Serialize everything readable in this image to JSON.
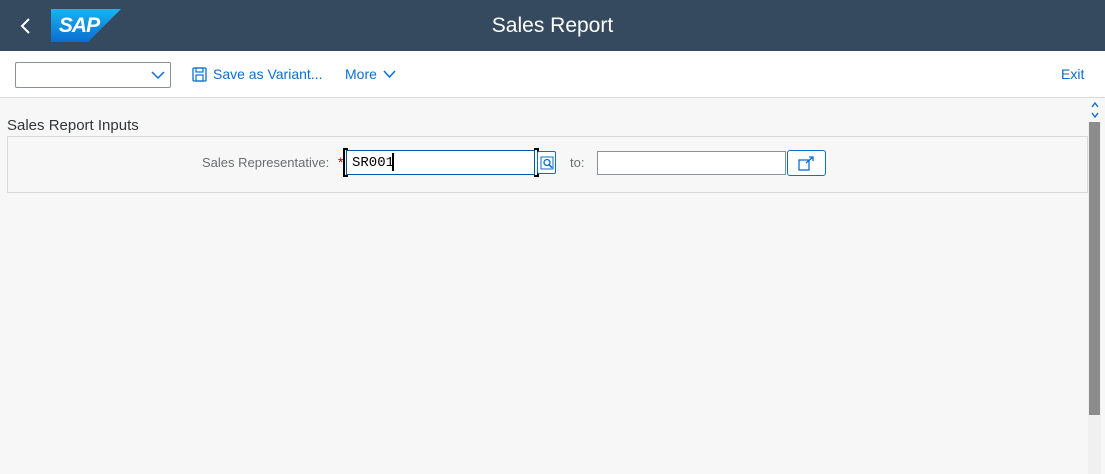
{
  "shell": {
    "logo_text": "SAP",
    "title": "Sales Report",
    "back_icon": "chevron-left-icon"
  },
  "toolbar": {
    "variant_value": "",
    "save_variant_label": "Save as Variant...",
    "more_label": "More",
    "exit_label": "Exit"
  },
  "form": {
    "section_title": "Sales Report Inputs",
    "sales_rep_label": "Sales Representative:",
    "required_marker": "*",
    "from_value": "SR001",
    "to_label": "to:",
    "to_value": ""
  },
  "colors": {
    "shell_bg": "#354a5f",
    "accent": "#0a6ed1",
    "required": "#bb0000",
    "logo_blue": "#0a8fe0"
  }
}
